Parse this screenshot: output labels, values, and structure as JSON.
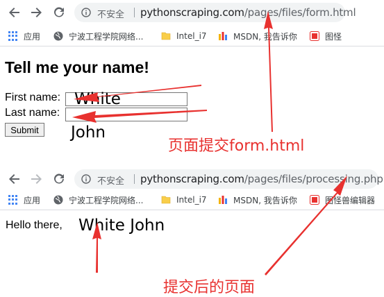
{
  "browser_top": {
    "insecure_label": "不安全",
    "url_host": "pythonscraping.com",
    "url_path": "/pages/files/form.html",
    "bookmarks": [
      {
        "label": "应用",
        "icon": "apps-grid-icon"
      },
      {
        "label": "宁波工程学院网络...",
        "icon": "globe-icon"
      },
      {
        "label": "Intel_i7",
        "icon": "folder-icon"
      },
      {
        "label": "MSDN, 我告诉你",
        "icon": "msdn-icon"
      },
      {
        "label": "图怪",
        "icon": "tuguai-icon"
      }
    ]
  },
  "form_page": {
    "heading": "Tell me your name!",
    "first_name_label": "First name:",
    "last_name_label": "Last name:",
    "submit_label": "Submit"
  },
  "browser_bottom": {
    "insecure_label": "不安全",
    "url_host": "pythonscraping.com",
    "url_path": "/pages/files/processing.php",
    "bookmarks": [
      {
        "label": "应用",
        "icon": "apps-grid-icon"
      },
      {
        "label": "宁波工程学院网络...",
        "icon": "globe-icon"
      },
      {
        "label": "Intel_i7",
        "icon": "folder-icon"
      },
      {
        "label": "MSDN, 我告诉你",
        "icon": "msdn-icon"
      },
      {
        "label": "图怪兽编辑器",
        "icon": "tuguai-icon"
      }
    ]
  },
  "result_page": {
    "hello_text": "Hello there,"
  },
  "annotations": {
    "first_value": "White",
    "last_value": "John",
    "result_value": "White John",
    "caption_form": "页面提交form.html",
    "caption_processing": "提交后的页面",
    "arrow_color": "#e8312f"
  }
}
